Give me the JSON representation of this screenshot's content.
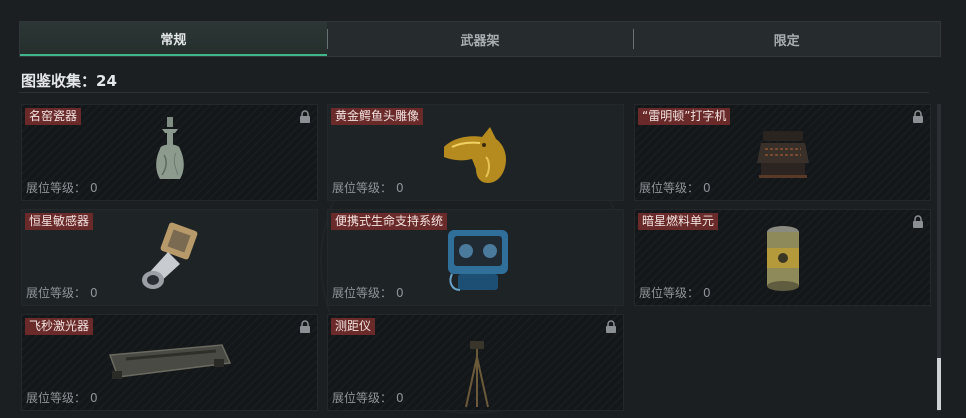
{
  "tabs": [
    {
      "label": "常规"
    },
    {
      "label": "武器架"
    },
    {
      "label": "限定"
    }
  ],
  "collection": {
    "label": "图鉴收集：",
    "count": "24"
  },
  "level_label": "展位等级：",
  "items": [
    {
      "name": "名窑瓷器",
      "level": "0",
      "locked": true,
      "icon": "porcelain-vase-icon"
    },
    {
      "name": "黄金鳄鱼头雕像",
      "level": "0",
      "locked": false,
      "icon": "golden-crocodile-head-icon"
    },
    {
      "name": "“雷明顿”打字机",
      "level": "0",
      "locked": true,
      "icon": "typewriter-icon"
    },
    {
      "name": "恒星敏感器",
      "level": "0",
      "locked": false,
      "icon": "star-sensor-icon"
    },
    {
      "name": "便携式生命支持系统",
      "level": "0",
      "locked": false,
      "icon": "life-support-system-icon"
    },
    {
      "name": "暗星燃料单元",
      "level": "0",
      "locked": true,
      "icon": "fuel-cell-icon"
    },
    {
      "name": "飞秒激光器",
      "level": "0",
      "locked": true,
      "icon": "laser-device-icon"
    },
    {
      "name": "测距仪",
      "level": "0",
      "locked": true,
      "icon": "rangefinder-tripod-icon"
    }
  ]
}
